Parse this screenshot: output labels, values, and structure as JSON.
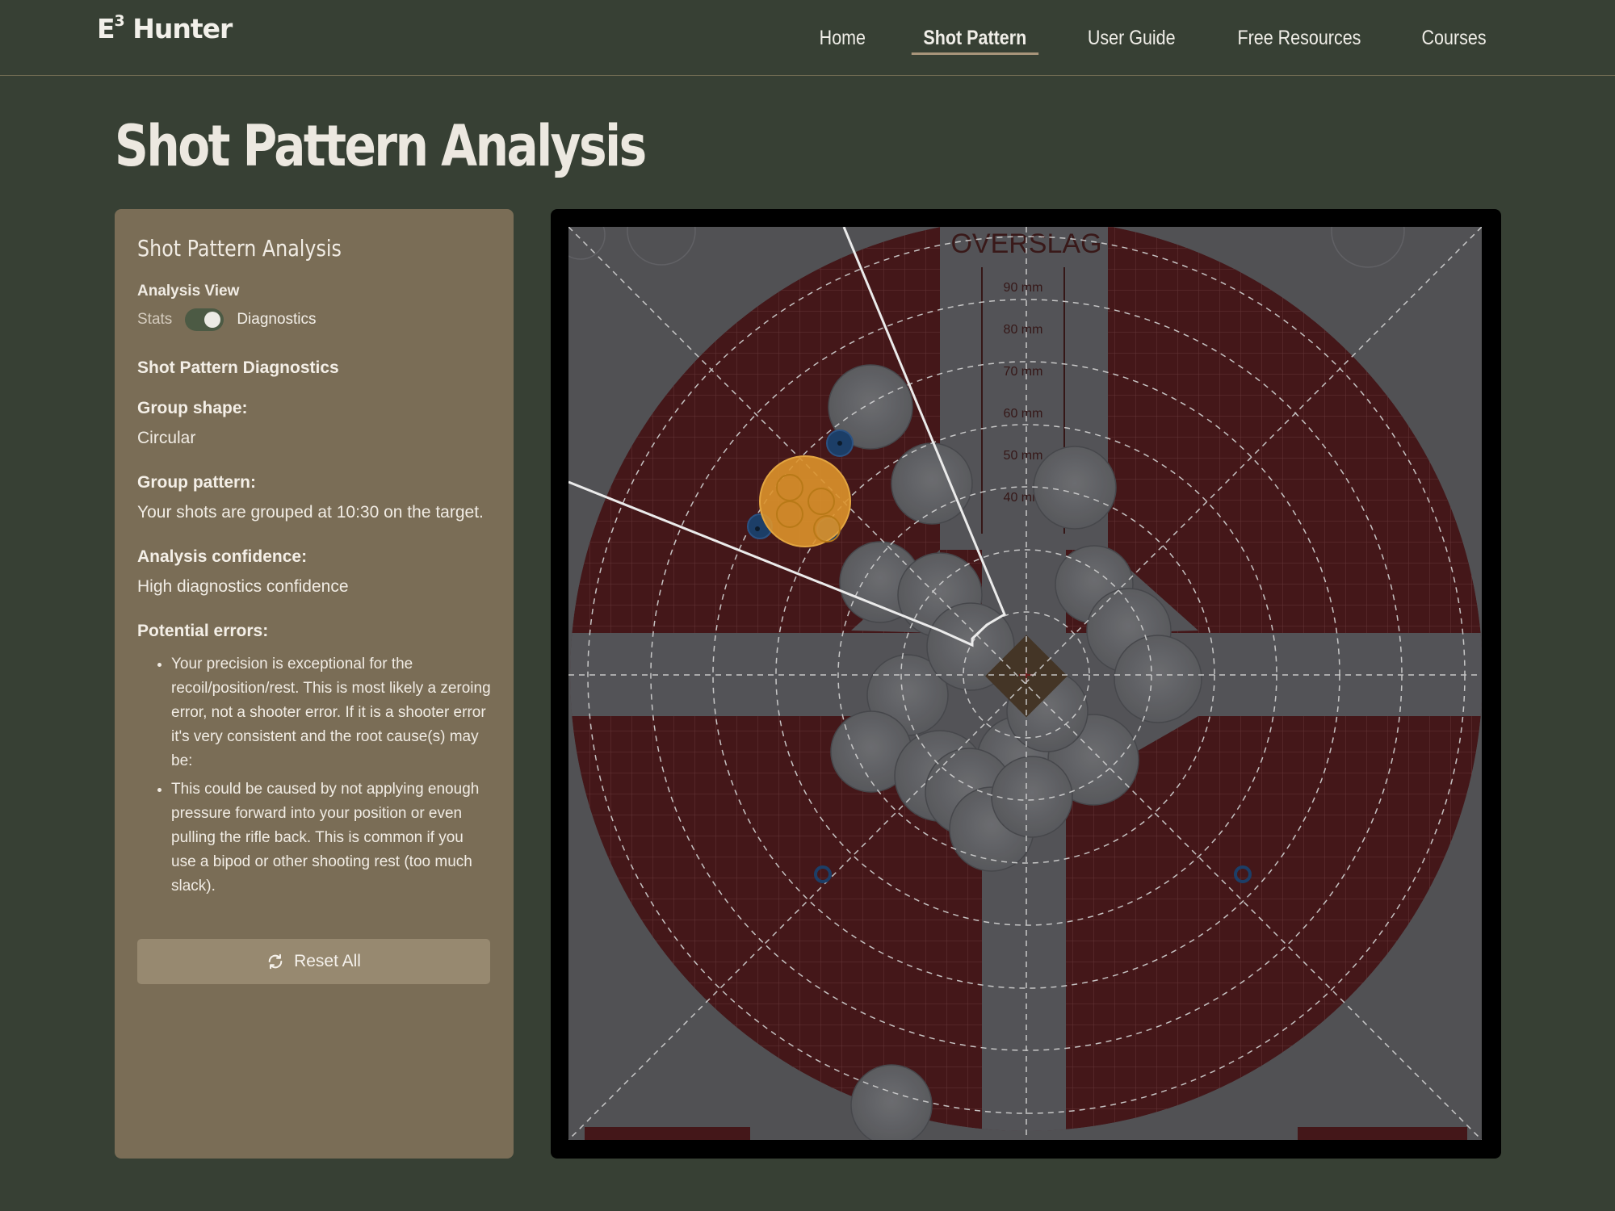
{
  "brand": {
    "name": "Hunter",
    "sup": "3",
    "prefix": "E"
  },
  "nav": {
    "items": [
      {
        "label": "Home"
      },
      {
        "label": "Shot Pattern"
      },
      {
        "label": "User Guide"
      },
      {
        "label": "Free Resources"
      },
      {
        "label": "Courses"
      }
    ],
    "active": "Shot Pattern"
  },
  "page_title": "Shot Pattern Analysis",
  "panel": {
    "title": "Shot Pattern Analysis",
    "view_label": "Analysis View",
    "toggle_off": "Stats",
    "toggle_on": "Diagnostics",
    "toggle_state": "Diagnostics",
    "section_heading": "Shot Pattern Diagnostics",
    "group_shape_label": "Group shape:",
    "group_shape_value": "Circular",
    "group_pattern_label": "Group pattern:",
    "group_pattern_value": "Your shots are grouped at 10:30 on the target.",
    "confidence_label": "Analysis confidence:",
    "confidence_value": "High diagnostics confidence",
    "errors_label": "Potential errors:",
    "errors": [
      "Your precision is exceptional for the recoil/position/rest. This is most likely a zeroing error, not a shooter error. If it is a shooter error it's very consistent and the root cause(s) may be:",
      "This could be caused by not applying enough pressure forward into your position or even pulling the rifle back. This is common if you use a bipod or other shooting rest (too much slack)."
    ],
    "reset_label": "Reset All"
  },
  "target": {
    "header_text": "OVERSLAG",
    "scale_labels": [
      "90 mm",
      "80 mm",
      "70 mm",
      "60 mm",
      "50 mm",
      "40 mm"
    ],
    "colors": {
      "red": "#4e1c1e",
      "paper": "#5b5b5f",
      "highlight": "#f0a030",
      "marker": "#1f4470"
    }
  }
}
